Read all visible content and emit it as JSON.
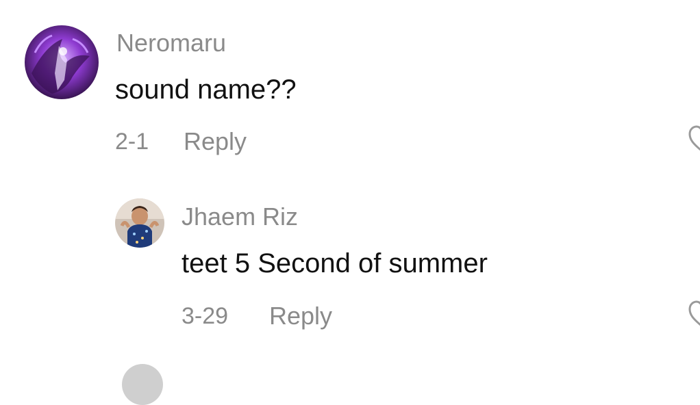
{
  "comments": [
    {
      "username": "Neromaru",
      "text": "sound name??",
      "date": "2-1",
      "reply_label": "Reply",
      "avatar_icon": "purple-dragon-avatar",
      "like_icon": "heart-outline-icon"
    },
    {
      "username": "Jhaem Riz",
      "text": "teet 5 Second of summer",
      "date": "3-29",
      "reply_label": "Reply",
      "avatar_icon": "child-photo-avatar",
      "like_icon": "heart-outline-icon"
    }
  ],
  "colors": {
    "meta_text": "#8a8a8a",
    "body_text": "#111111",
    "background": "#ffffff"
  }
}
